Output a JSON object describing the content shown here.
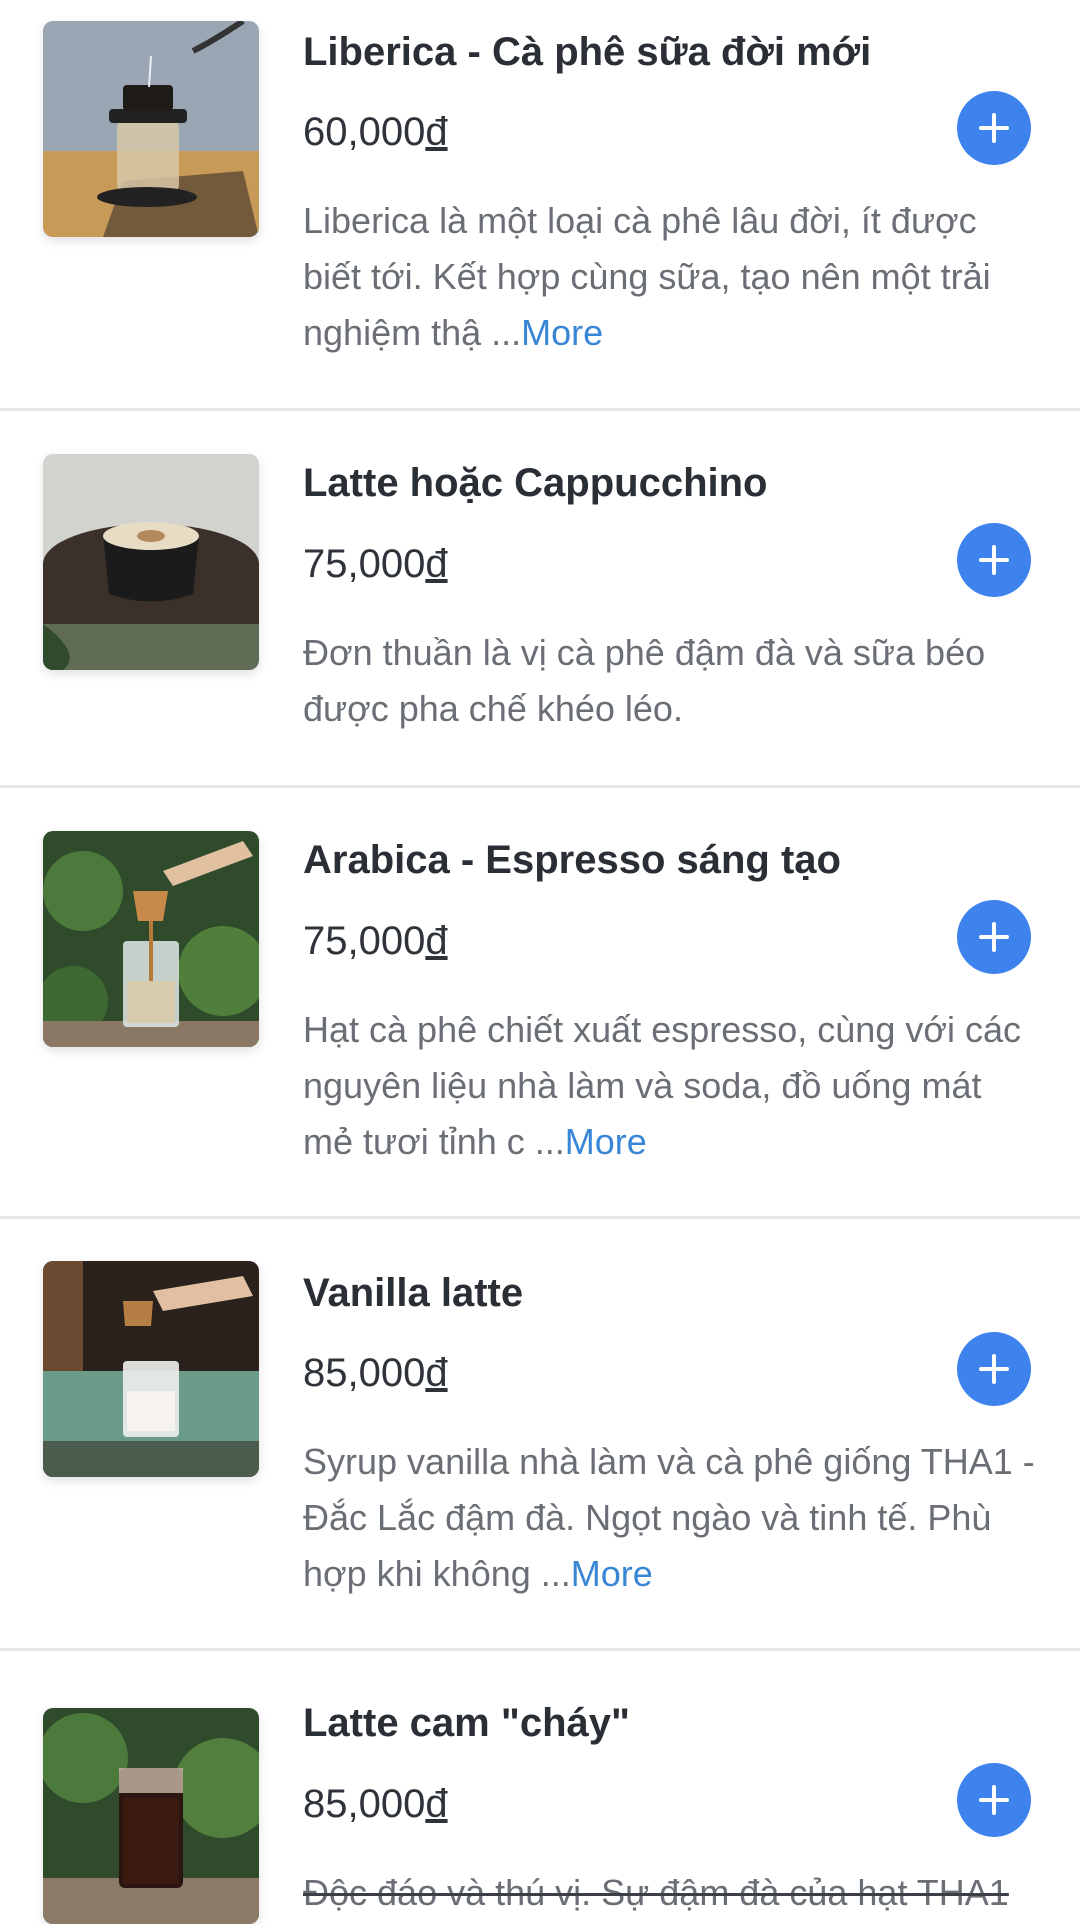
{
  "colors": {
    "accent": "#3e82ee",
    "link": "#3a86d6",
    "divider": "#e6e7ea"
  },
  "more_label": "More",
  "add_icon": "plus-icon",
  "items": [
    {
      "name": "Liberica - Cà phê sữa đời mới",
      "price": "60,000",
      "currency": "đ",
      "desc": "Liberica là một loại cà phê lâu đời, ít được biết tới. Kết hợp cùng sữa, tạo nên một trải nghiệm thậ ...",
      "has_more": true
    },
    {
      "name": "Latte hoặc Cappucchino",
      "price": "75,000",
      "currency": "đ",
      "desc": "Đơn thuần là vị cà phê đậm đà và sữa béo được pha chế khéo léo.",
      "has_more": false
    },
    {
      "name": "Arabica - Espresso sáng tạo",
      "price": "75,000",
      "currency": "đ",
      "desc": "Hạt cà phê chiết xuất espresso, cùng với các nguyên liệu nhà làm và soda, đồ uống mát mẻ tươi tỉnh c ...",
      "has_more": true
    },
    {
      "name": "Vanilla latte",
      "price": "85,000",
      "currency": "đ",
      "desc": "Syrup vanilla nhà làm và cà phê giống THA1 - Đắc Lắc đậm đà. Ngọt ngào và tinh tế. Phù hợp khi không ...",
      "has_more": true
    },
    {
      "name": "Latte cam \"cháy\"",
      "price": "85,000",
      "currency": "đ",
      "desc": "Độc đáo và thú vị. Sự đậm đà của hạt THA1",
      "has_more": false
    }
  ]
}
